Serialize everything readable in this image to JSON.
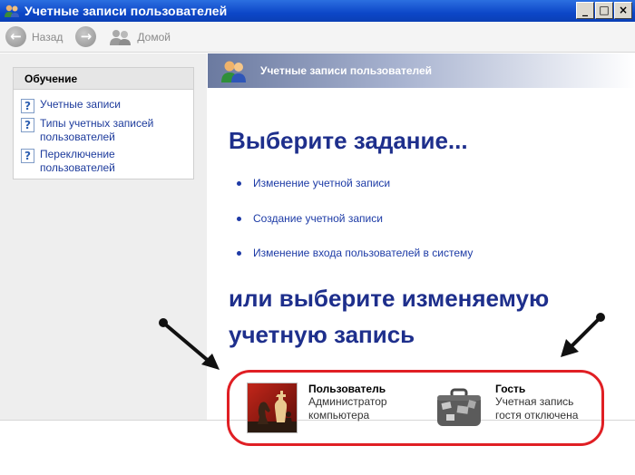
{
  "window": {
    "title": "Учетные записи пользователей",
    "controls": {
      "minimize": "_",
      "maximize": "□",
      "close": "×"
    }
  },
  "toolbar": {
    "back_label": "Назад",
    "home_label": "Домой",
    "back_icon": "←",
    "forward_icon": "→"
  },
  "sidebar": {
    "heading": "Обучение",
    "items": [
      {
        "label_lines": [
          "Учетные записи"
        ],
        "icon": "help-icon"
      },
      {
        "label_lines": [
          "Типы учетных записей",
          "пользователей"
        ],
        "icon": "help-icon"
      },
      {
        "label_lines": [
          "Переключение",
          "пользователей"
        ],
        "icon": "help-icon"
      }
    ],
    "help_glyph": "?"
  },
  "header": {
    "title": "Учетные записи пользователей"
  },
  "main": {
    "heading": "Выберите задание...",
    "tasks": [
      "Изменение учетной записи",
      "Создание учетной записи",
      "Изменение входа пользователей в систему"
    ],
    "heading2_line1": "или выберите изменяемую",
    "heading2_line2": "учетную запись",
    "accounts": [
      {
        "name": "Пользователь",
        "desc_line1": "Администратор",
        "desc_line2": "компьютера",
        "picture": "chess-icon"
      },
      {
        "name": "Гость",
        "desc_line1": "Учетная запись",
        "desc_line2": "гостя отключена",
        "picture": "suitcase-icon"
      }
    ]
  },
  "colors": {
    "titlebar": "#0d47c8",
    "heading": "#1e2f8c",
    "link": "#1d3ba6",
    "highlight_ring": "#e01f24"
  }
}
